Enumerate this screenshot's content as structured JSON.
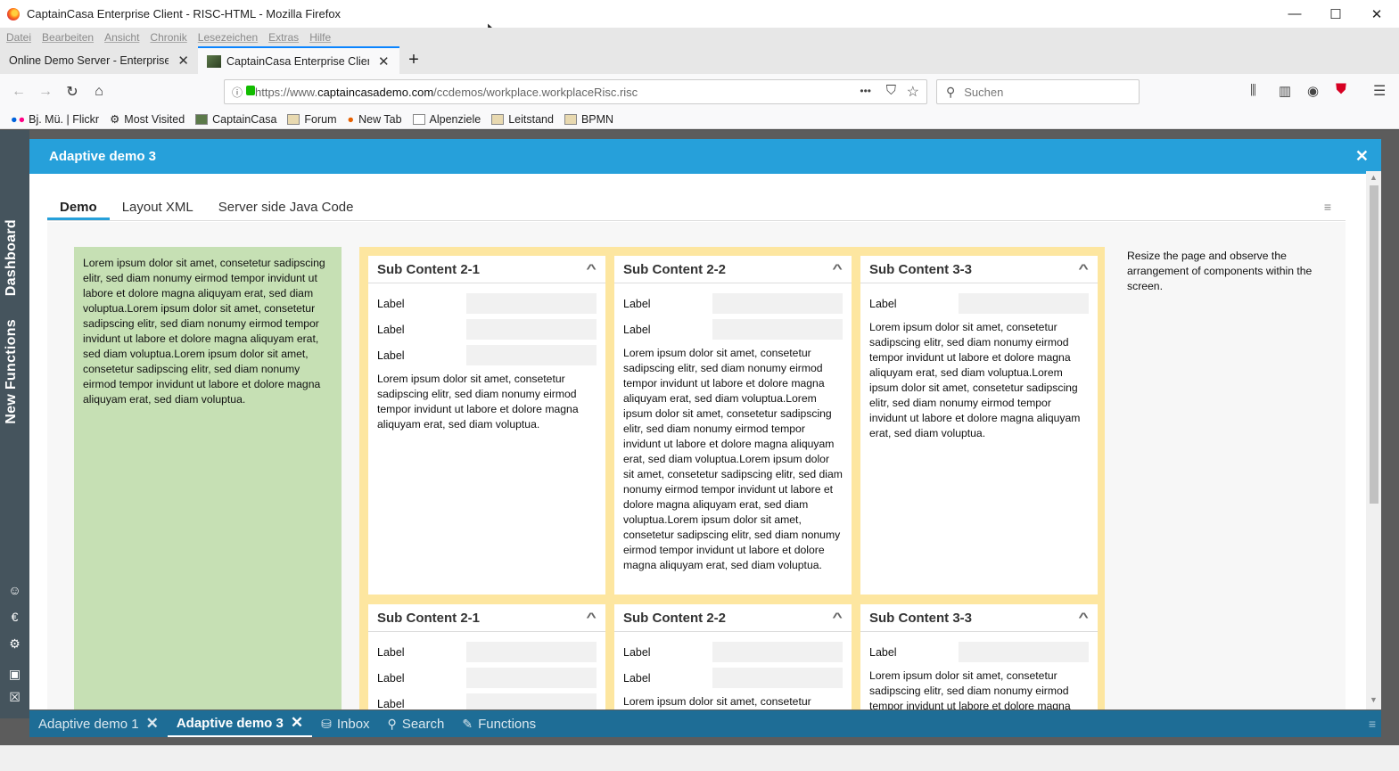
{
  "window": {
    "title": "CaptainCasa Enterprise Client - RISC-HTML - Mozilla Firefox",
    "minimize": "—",
    "maximize": "☐",
    "close": "✕"
  },
  "menu": [
    "Datei",
    "Bearbeiten",
    "Ansicht",
    "Chronik",
    "Lesezeichen",
    "Extras",
    "Hilfe"
  ],
  "browser_tabs": [
    {
      "label": "Online Demo Server - Enterprise Cli",
      "close": "✕"
    },
    {
      "label": "CaptainCasa Enterprise Client -",
      "close": "✕"
    }
  ],
  "new_tab": "+",
  "nav": {
    "back": "←",
    "forward": "→",
    "reload": "↻",
    "home": "⌂",
    "url_prefix": "https://www.",
    "url_domain": "captaincasademo.com",
    "url_path": "/ccdemos/workplace.workplaceRisc.risc",
    "more": "•••",
    "search_placeholder": "Suchen"
  },
  "bookmarks": [
    "Bj. Mü. | Flickr",
    "Most Visited",
    "CaptainCasa",
    "Forum",
    "New Tab",
    "Alpenziele",
    "Leitstand",
    "BPMN"
  ],
  "sidebar": {
    "dashboard": "Dashboard",
    "new_functions": "New Functions"
  },
  "dialog": {
    "title": "Adaptive demo 3",
    "close": "✕",
    "tabs": [
      "Demo",
      "Layout XML",
      "Server side Java Code"
    ]
  },
  "green_text": "Lorem ipsum dolor sit amet, consetetur sadipscing elitr, sed diam nonumy eirmod tempor invidunt ut labore et dolore magna aliquyam erat, sed diam voluptua.Lorem ipsum dolor sit amet, consetetur sadipscing elitr, sed diam nonumy eirmod tempor invidunt ut labore et dolore magna aliquyam erat, sed diam voluptua.Lorem ipsum dolor sit amet, consetetur sadipscing elitr, sed diam nonumy eirmod tempor invidunt ut labore et dolore magna aliquyam erat, sed diam voluptua.",
  "hint": "Resize the page and observe the arrangement of components within the screen.",
  "cards": {
    "c1": {
      "title": "Sub Content 2-1",
      "label": "Label",
      "text": "Lorem ipsum dolor sit amet, consetetur sadipscing elitr, sed diam nonumy eirmod tempor invidunt ut labore et dolore magna aliquyam erat, sed diam voluptua."
    },
    "c2": {
      "title": "Sub Content 2-2",
      "label": "Label",
      "text": "Lorem ipsum dolor sit amet, consetetur sadipscing elitr, sed diam nonumy eirmod tempor invidunt ut labore et dolore magna aliquyam erat, sed diam voluptua.Lorem ipsum dolor sit amet, consetetur sadipscing elitr, sed diam nonumy eirmod tempor invidunt ut labore et dolore magna aliquyam erat, sed diam voluptua.Lorem ipsum dolor sit amet, consetetur sadipscing elitr, sed diam nonumy eirmod tempor invidunt ut labore et dolore magna aliquyam erat, sed diam voluptua.Lorem ipsum dolor sit amet, consetetur sadipscing elitr, sed diam nonumy eirmod tempor invidunt ut labore et dolore magna aliquyam erat, sed diam voluptua."
    },
    "c3": {
      "title": "Sub Content 3-3",
      "label": "Label",
      "text": "Lorem ipsum dolor sit amet, consetetur sadipscing elitr, sed diam nonumy eirmod tempor invidunt ut labore et dolore magna aliquyam erat, sed diam voluptua.Lorem ipsum dolor sit amet, consetetur sadipscing elitr, sed diam nonumy eirmod tempor invidunt ut labore et dolore magna aliquyam erat, sed diam voluptua."
    },
    "c4": {
      "title": "Sub Content 2-1",
      "label": "Label"
    },
    "c5": {
      "title": "Sub Content 2-2",
      "label": "Label",
      "text": "Lorem ipsum dolor sit amet, consetetur"
    },
    "c6": {
      "title": "Sub Content 3-3",
      "label": "Label",
      "text": "Lorem ipsum dolor sit amet, consetetur sadipscing elitr, sed diam nonumy eirmod tempor invidunt ut labore et dolore magna"
    }
  },
  "bottom_tabs": [
    {
      "label": "Adaptive demo 1",
      "close": "✕"
    },
    {
      "label": "Adaptive demo 3",
      "close": "✕"
    },
    {
      "label": "Inbox"
    },
    {
      "label": "Search"
    },
    {
      "label": "Functions"
    }
  ],
  "colors": {
    "dialog_header": "#26a0da",
    "green_panel": "#c6e0b4",
    "yellow_panel": "#fde6a0",
    "bottom_bar": "#1e6d96"
  }
}
